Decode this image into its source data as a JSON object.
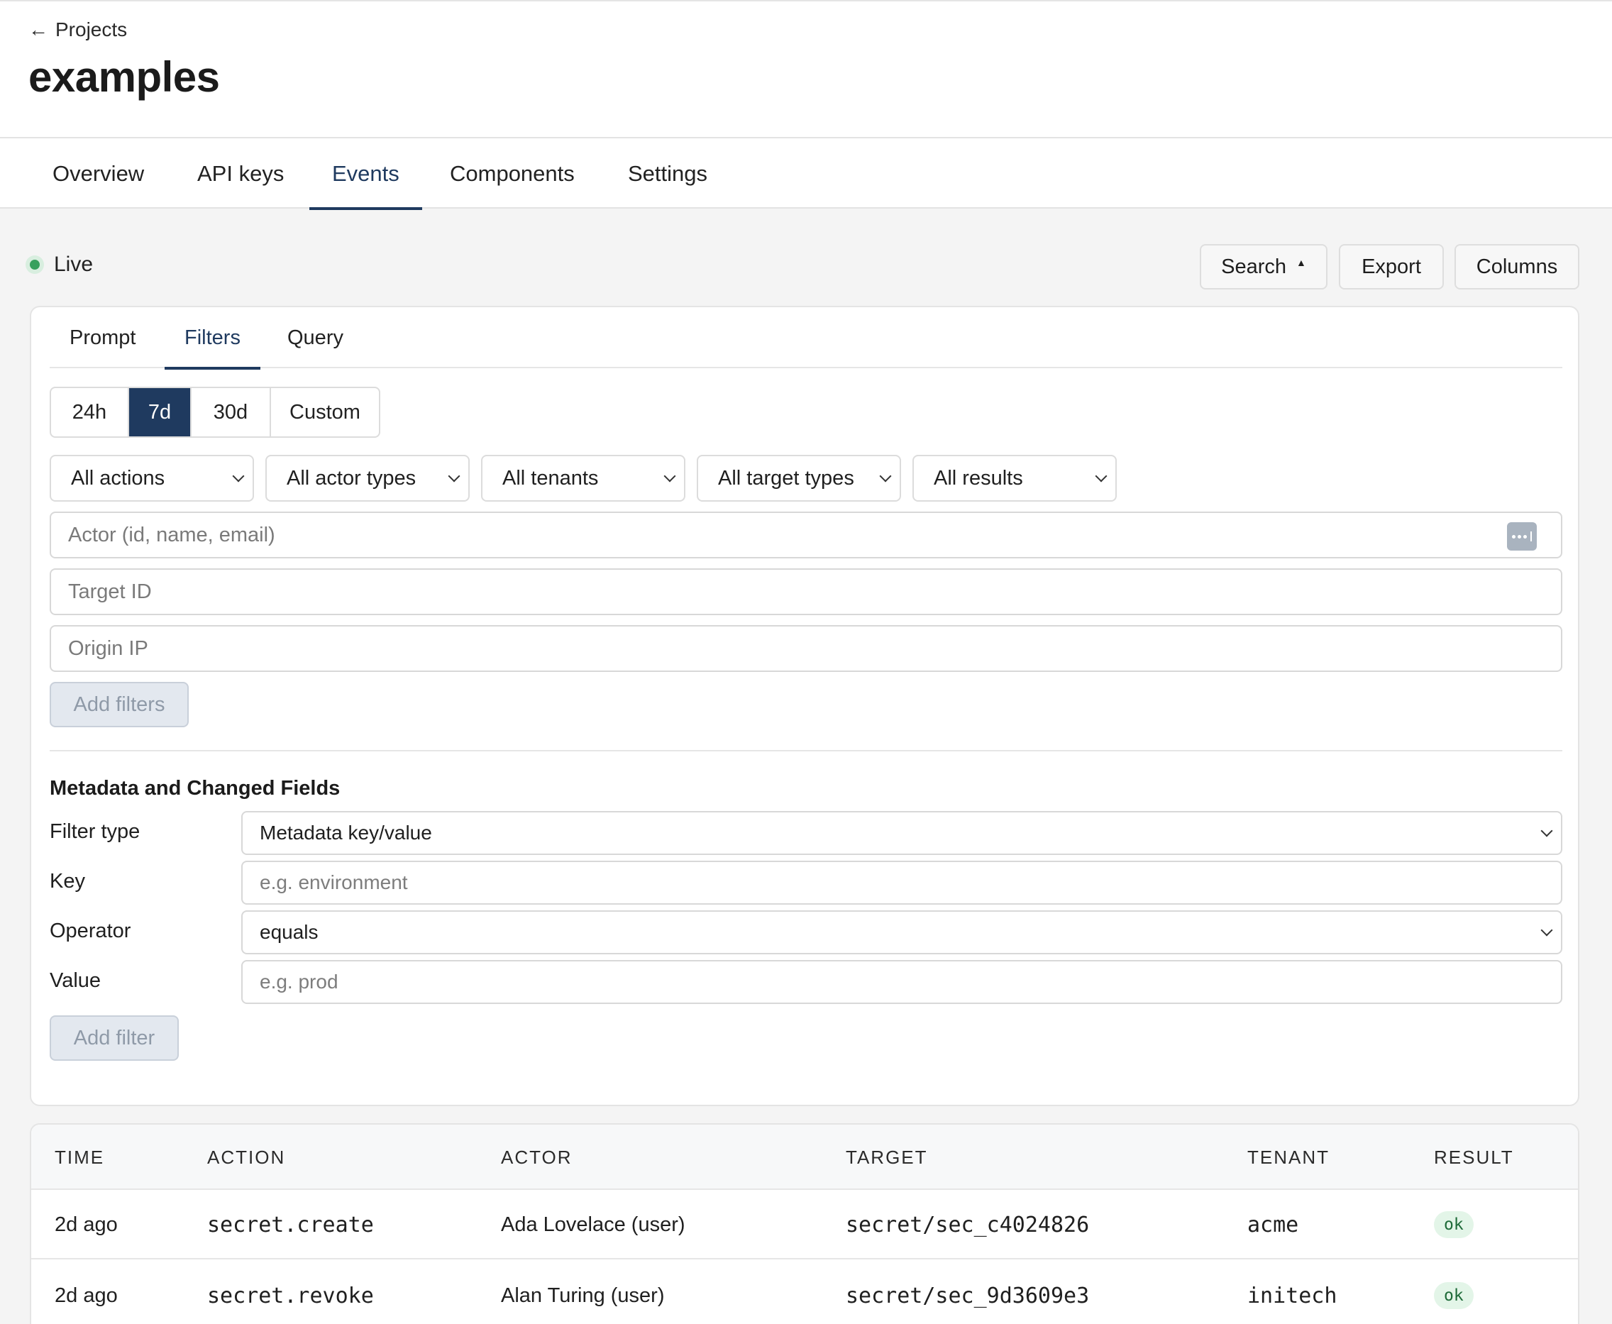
{
  "header": {
    "back_label": "Projects",
    "title": "examples"
  },
  "nav_tabs": [
    {
      "label": "Overview",
      "active": false
    },
    {
      "label": "API keys",
      "active": false
    },
    {
      "label": "Events",
      "active": true
    },
    {
      "label": "Components",
      "active": false
    },
    {
      "label": "Settings",
      "active": false
    }
  ],
  "toolbar": {
    "live_label": "Live",
    "search_label": "Search",
    "export_label": "Export",
    "columns_label": "Columns"
  },
  "filter_tabs": [
    {
      "label": "Prompt",
      "active": false
    },
    {
      "label": "Filters",
      "active": true
    },
    {
      "label": "Query",
      "active": false
    }
  ],
  "time_range": {
    "options": [
      "24h",
      "7d",
      "30d",
      "Custom"
    ],
    "selected": "7d"
  },
  "dropdowns": {
    "actions": "All actions",
    "actor_types": "All actor types",
    "tenants": "All tenants",
    "target_types": "All target types",
    "results": "All results"
  },
  "inputs": {
    "actor_placeholder": "Actor (id, name, email)",
    "target_placeholder": "Target ID",
    "origin_placeholder": "Origin IP"
  },
  "add_filters_label": "Add filters",
  "metadata": {
    "title": "Metadata and Changed Fields",
    "filter_type_label": "Filter type",
    "filter_type_value": "Metadata key/value",
    "key_label": "Key",
    "key_placeholder": "e.g. environment",
    "operator_label": "Operator",
    "operator_value": "equals",
    "value_label": "Value",
    "value_placeholder": "e.g. prod",
    "add_filter_label": "Add filter"
  },
  "table": {
    "columns": [
      "TIME",
      "ACTION",
      "ACTOR",
      "TARGET",
      "TENANT",
      "RESULT"
    ],
    "rows": [
      {
        "time": "2d ago",
        "action": "secret.create",
        "actor": "Ada Lovelace (user)",
        "target": "secret/sec_c4024826",
        "tenant": "acme",
        "result": "ok"
      },
      {
        "time": "2d ago",
        "action": "secret.revoke",
        "actor": "Alan Turing (user)",
        "target": "secret/sec_9d3609e3",
        "tenant": "initech",
        "result": "ok"
      }
    ]
  },
  "colors": {
    "accent": "#1f3a5f",
    "live_green": "#37a05d",
    "ok_badge_bg": "#e3f5e8"
  }
}
